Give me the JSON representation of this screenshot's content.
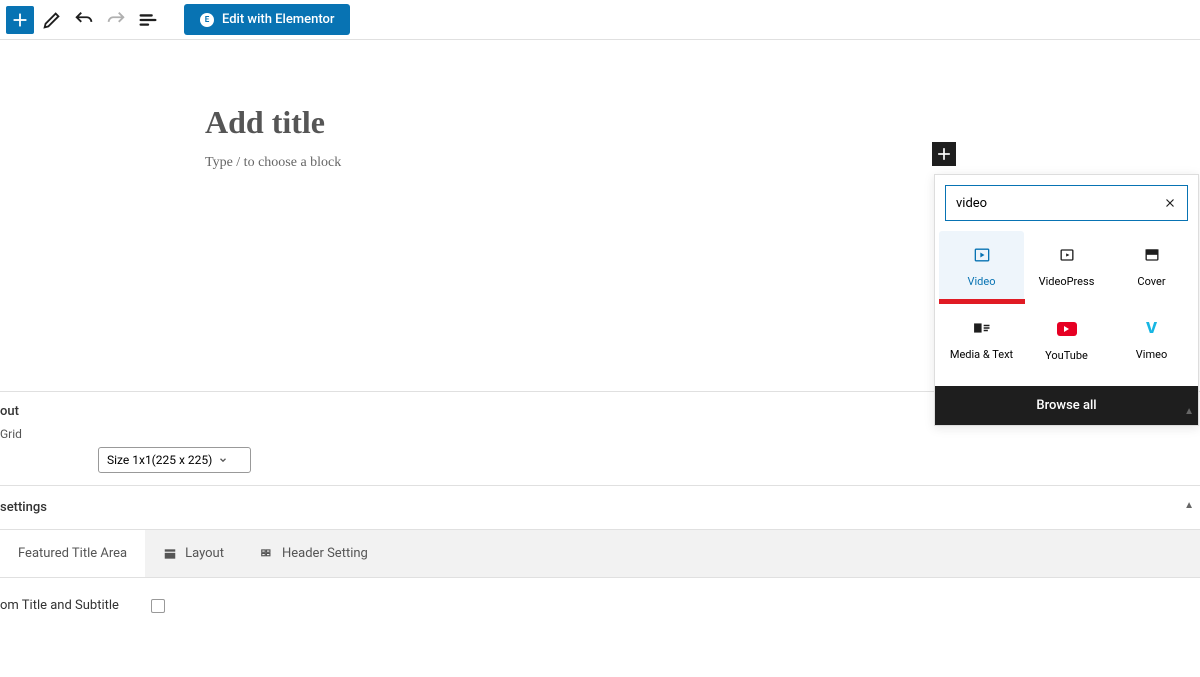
{
  "toolbar": {
    "elementor_label": "Edit with Elementor"
  },
  "editor": {
    "title_placeholder": "Add title",
    "content_placeholder": "Type / to choose a block"
  },
  "block_popup": {
    "search_value": "video",
    "tiles": {
      "video": "Video",
      "videopress": "VideoPress",
      "cover": "Cover",
      "media_text": "Media & Text",
      "youtube": "YouTube",
      "vimeo": "Vimeo"
    },
    "browse_all": "Browse all"
  },
  "panels": {
    "layout_header": "out",
    "grid_label": "Grid",
    "size_value": "Size 1x1(225 x 225)",
    "settings_header": "settings"
  },
  "tabs": {
    "featured": "Featured Title Area",
    "layout": "Layout",
    "header_setting": "Header Setting"
  },
  "checkbox_label": "om Title and Subtitle"
}
